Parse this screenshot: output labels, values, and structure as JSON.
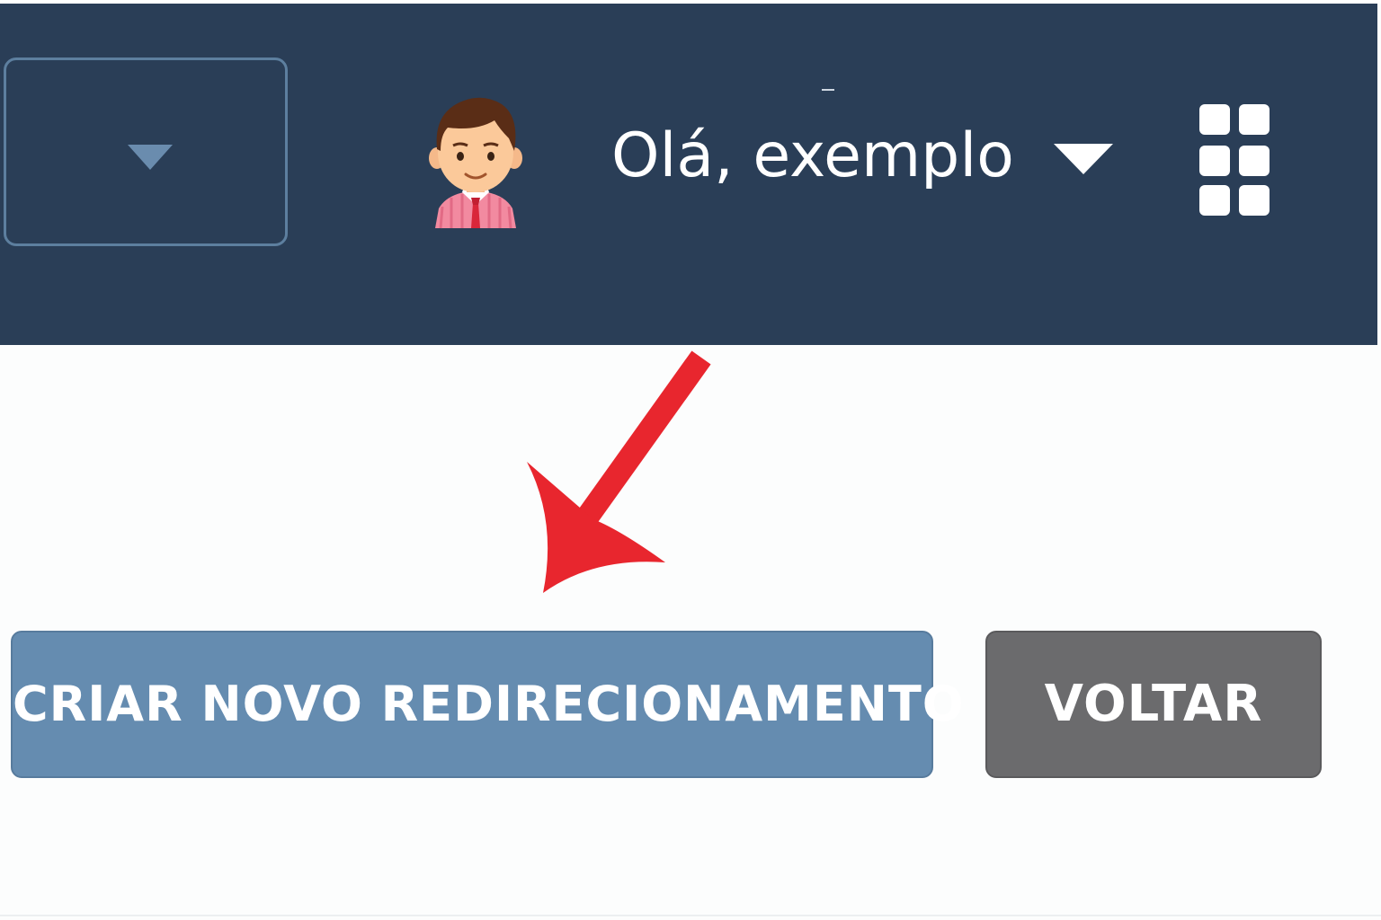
{
  "header": {
    "background_color": "#2a3e57",
    "dropdown_icon": "caret-down-icon",
    "user": {
      "avatar_icon": "man-avatar-icon",
      "greeting": "Olá, exemplo",
      "menu_icon": "caret-down-icon"
    },
    "apps_icon": "grid-apps-icon"
  },
  "annotation": {
    "icon": "red-arrow-icon",
    "color": "#e8262e"
  },
  "actions": {
    "create_redirect_label": "CRIAR NOVO REDIRECIONAMENTO",
    "create_redirect_color": "#658cb0",
    "back_label": "VOLTAR",
    "back_color": "#6b6b6d"
  }
}
